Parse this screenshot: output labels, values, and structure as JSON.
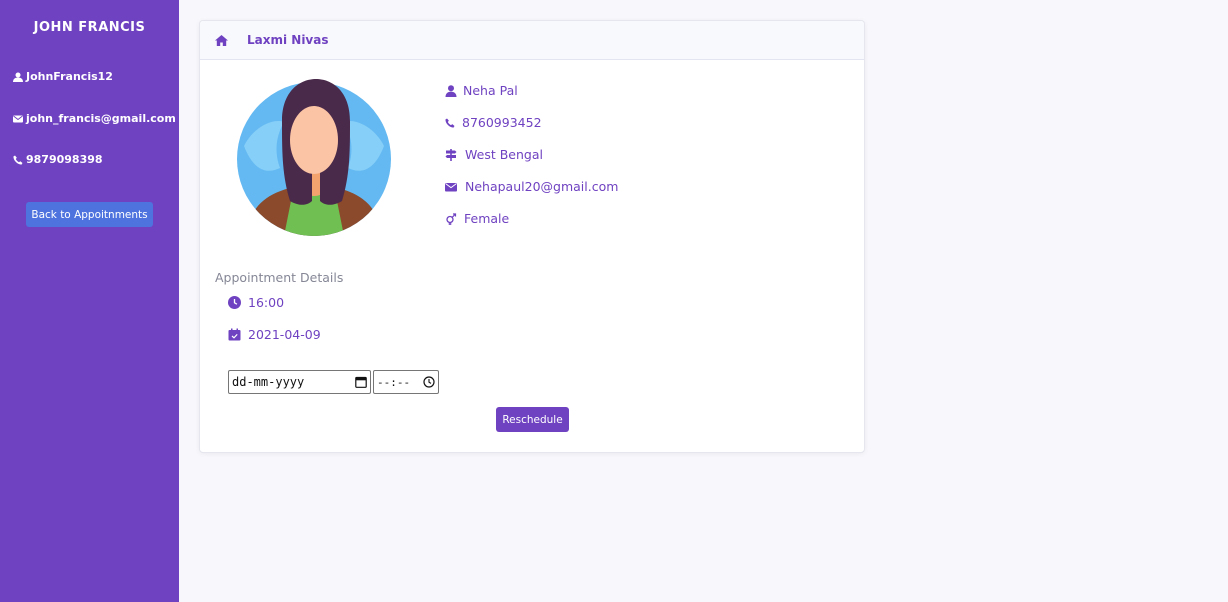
{
  "sidebar": {
    "name": "JOHN FRANCIS",
    "username": "JohnFrancis12",
    "email": "john_francis@gmail.com",
    "phone": "9879098398",
    "back_label": "Back to Appoitnments"
  },
  "card": {
    "title": "Laxmi Nivas"
  },
  "patient": {
    "name": "Neha Pal",
    "phone": "8760993452",
    "state": "West Bengal",
    "email": "Nehapaul20@gmail.com",
    "gender": "Female"
  },
  "appointment": {
    "heading": "Appointment Details",
    "time": "16:00",
    "date": "2021-04-09"
  },
  "reschedule": {
    "date_placeholder": "dd-mm-yyyy",
    "time_placeholder": "--:--",
    "button_label": "Reschedule"
  },
  "colors": {
    "primary": "#6f42c1",
    "button_blue": "#4e73df",
    "muted_text": "#858796"
  }
}
